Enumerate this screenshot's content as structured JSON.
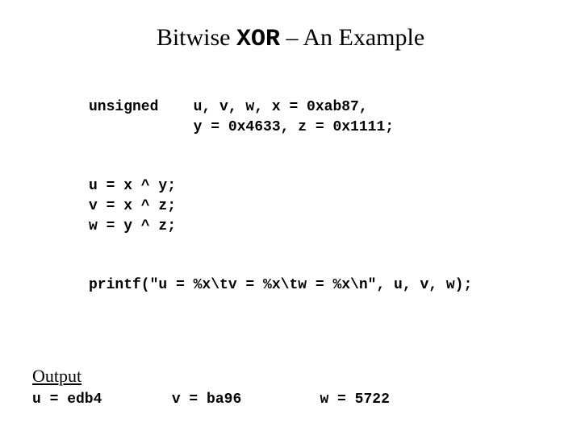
{
  "title": {
    "pre": "Bitwise ",
    "mono": "XOR",
    "post": " – An Example"
  },
  "code": {
    "decl1": "unsigned    u, v, w, x = 0xab87,",
    "decl2": "            y = 0x4633, z = 0x1111;",
    "assign1": "u = x ^ y;",
    "assign2": "v = x ^ z;",
    "assign3": "w = y ^ z;",
    "printf": "printf(\"u = %x\\tv = %x\\tw = %x\\n\", u, v, w);"
  },
  "output": {
    "label": "Output",
    "line": "u = edb4        v = ba96         w = 5722"
  },
  "chart_data": {
    "type": "table",
    "title": "Bitwise XOR Example",
    "inputs": {
      "x": "0xab87",
      "y": "0x4633",
      "z": "0x1111"
    },
    "computations": [
      {
        "var": "u",
        "expr": "x ^ y",
        "result_hex": "edb4"
      },
      {
        "var": "v",
        "expr": "x ^ z",
        "result_hex": "ba96"
      },
      {
        "var": "w",
        "expr": "y ^ z",
        "result_hex": "5722"
      }
    ]
  }
}
